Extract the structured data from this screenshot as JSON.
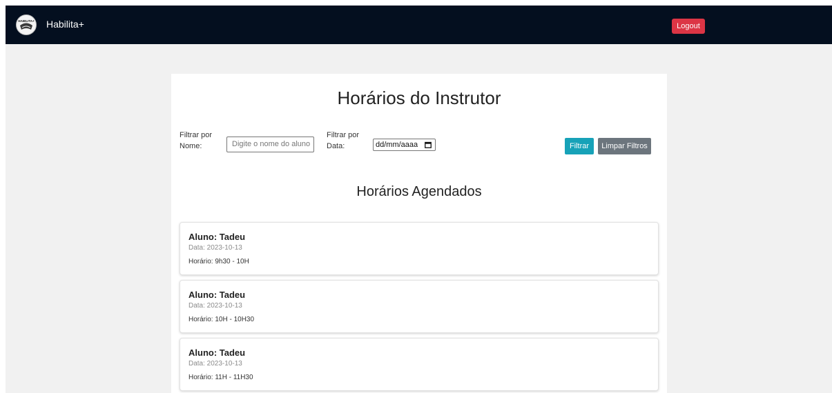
{
  "navbar": {
    "brand_name": "Habilita+",
    "logo_text": "HABILITA+",
    "logout_label": "Logout"
  },
  "page": {
    "title": "Horários do Instrutor",
    "section_title": "Horários Agendados"
  },
  "filters": {
    "name_label_line1": "Filtrar por",
    "name_label_line2": "Nome:",
    "name_placeholder": "Digite o nome do aluno",
    "date_label_line1": "Filtrar por",
    "date_label_line2": "Data:",
    "date_value": "dd/mm/aaaa",
    "filter_button": "Filtrar",
    "clear_button": "Limpar Filtros"
  },
  "appointments": [
    {
      "student": "Aluno: Tadeu",
      "date": "Data: 2023-10-13",
      "time": "Horário: 9h30 - 10H"
    },
    {
      "student": "Aluno: Tadeu",
      "date": "Data: 2023-10-13",
      "time": "Horário: 10H - 10H30"
    },
    {
      "student": "Aluno: Tadeu",
      "date": "Data: 2023-10-13",
      "time": "Horário: 11H - 11H30"
    }
  ],
  "colors": {
    "navbar": "#040f1f",
    "logout": "#dc3545",
    "filter": "#17a2b8",
    "clear": "#6c757d",
    "background": "#f1f1f1"
  },
  "icons": [
    "logo-icon",
    "calendar-icon"
  ]
}
